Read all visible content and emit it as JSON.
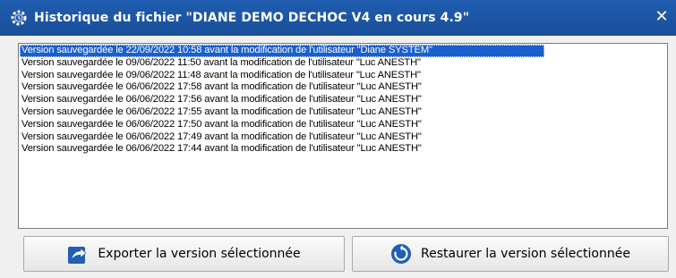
{
  "window": {
    "title": "Historique du fichier \"DIANE DEMO DECHOC V4 en cours 4.9\"",
    "close_label": "✕",
    "app_icon": "gear-history-icon"
  },
  "history": {
    "items": [
      {
        "label": "Version sauvegardée le 22/09/2022 10:58 avant la modification de l'utilisateur \"Diane SYSTEM\"",
        "selected": true
      },
      {
        "label": "Version sauvegardée le 09/06/2022 11:50 avant la modification de l'utilisateur \"Luc ANESTH\"",
        "selected": false
      },
      {
        "label": "Version sauvegardée le 09/06/2022 11:48 avant la modification de l'utilisateur \"Luc ANESTH\"",
        "selected": false
      },
      {
        "label": "Version sauvegardée le 06/06/2022 17:58 avant la modification de l'utilisateur \"Luc ANESTH\"",
        "selected": false
      },
      {
        "label": "Version sauvegardée le 06/06/2022 17:56 avant la modification de l'utilisateur \"Luc ANESTH\"",
        "selected": false
      },
      {
        "label": "Version sauvegardée le 06/06/2022 17:55 avant la modification de l'utilisateur \"Luc ANESTH\"",
        "selected": false
      },
      {
        "label": "Version sauvegardée le 06/06/2022 17:50 avant la modification de l'utilisateur \"Luc ANESTH\"",
        "selected": false
      },
      {
        "label": "Version sauvegardée le 06/06/2022 17:49 avant la modification de l'utilisateur \"Luc ANESTH\"",
        "selected": false
      },
      {
        "label": "Version sauvegardée le 06/06/2022 17:44 avant la modification de l'utilisateur \"Luc ANESTH\"",
        "selected": false
      }
    ]
  },
  "buttons": {
    "export_label": "Exporter la version sélectionnée",
    "export_icon": "export-icon",
    "restore_label": "Restaurer la version sélectionnée",
    "restore_icon": "restore-icon"
  },
  "colors": {
    "titlebar": "#1f5cb0",
    "selection": "#1a5fce",
    "icon_blue": "#1f5fb5"
  }
}
